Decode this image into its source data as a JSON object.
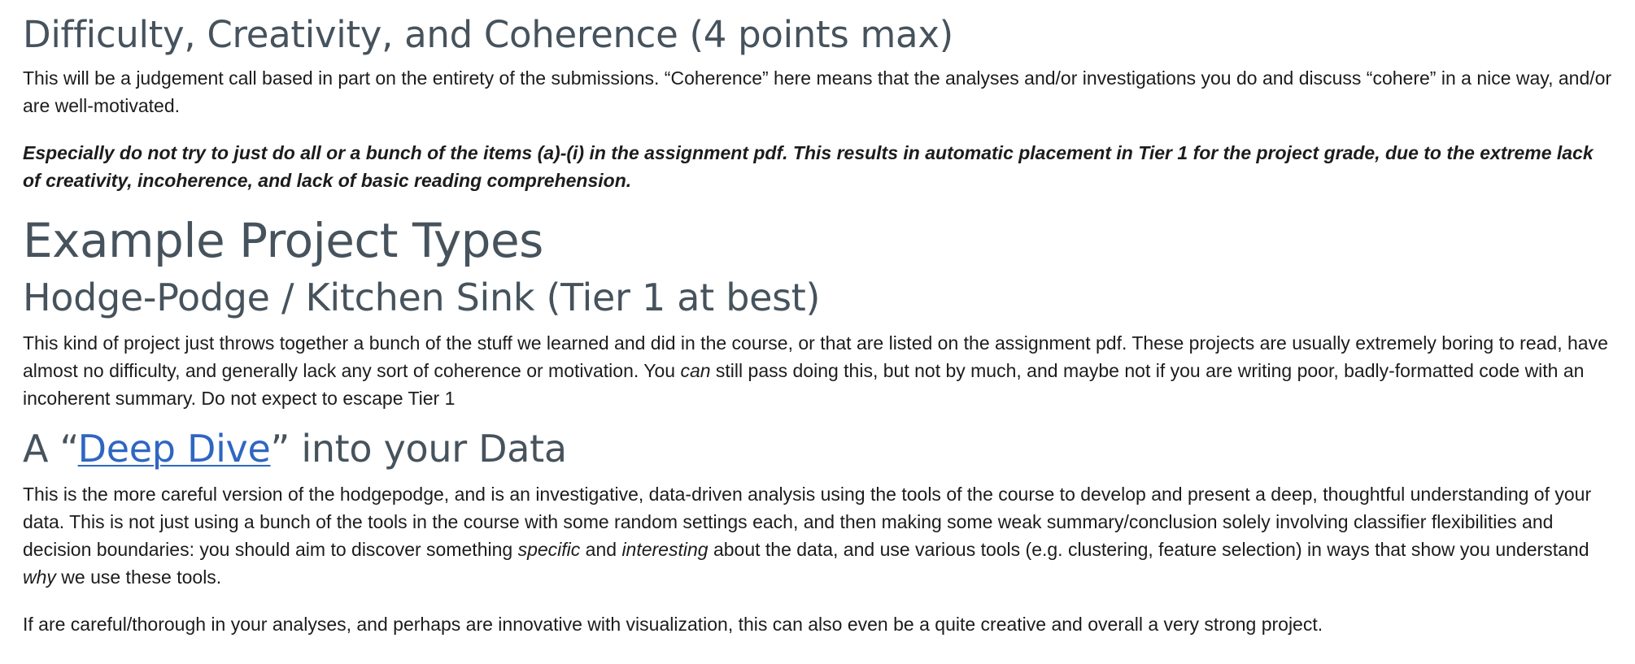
{
  "difficulty": {
    "heading": "Difficulty, Creativity, and Coherence (4 points max)",
    "para1": "This will be a judgement call based in part on the entirety of the submissions. “Coherence” here means that the analyses and/or investigations you do and discuss “cohere” in a nice way, and/or are well-motivated.",
    "para2": "Especially do not try to just do all or a bunch of the items (a)-(i) in the assignment pdf. This results in automatic placement in Tier 1 for the project grade, due to the extreme lack of creativity, incoherence, and lack of basic reading comprehension."
  },
  "examples": {
    "heading": "Example Project Types"
  },
  "hodgepodge": {
    "heading": "Hodge-Podge / Kitchen Sink (Tier 1 at best)",
    "text_before": "This kind of project just throws together a bunch of the stuff we learned and did in the course, or that are listed on the assignment pdf. These projects are usually extremely boring to read, have almost no difficulty, and generally lack any sort of coherence or motivation. You ",
    "emph": "can",
    "text_after": " still pass doing this, but not by much, and maybe not if you are writing poor, badly-formatted code with an incoherent summary. Do not expect to escape Tier 1"
  },
  "deep_dive": {
    "heading_prefix": "A “",
    "heading_link": "Deep Dive",
    "heading_suffix": "” into your Data",
    "para1_a": "This is the more careful version of the hodgepodge, and is an investigative, data-driven analysis using the tools of the course to develop and present a deep, thoughtful understanding of your data. This is not just using a bunch of the tools in the course with some random settings each, and then making some weak summary/conclusion solely involving classifier flexibilities and decision boundaries: you should aim to discover something ",
    "para1_em1": "specific",
    "para1_b": " and ",
    "para1_em2": "interesting",
    "para1_c": " about the data, and use various tools (e.g. clustering, feature selection) in ways that show you understand ",
    "para1_em3": "why",
    "para1_d": " we use these tools.",
    "para2": "If are careful/thorough in your analyses, and perhaps are innovative with visualization, this can also even be a quite creative and overall a very strong project."
  }
}
